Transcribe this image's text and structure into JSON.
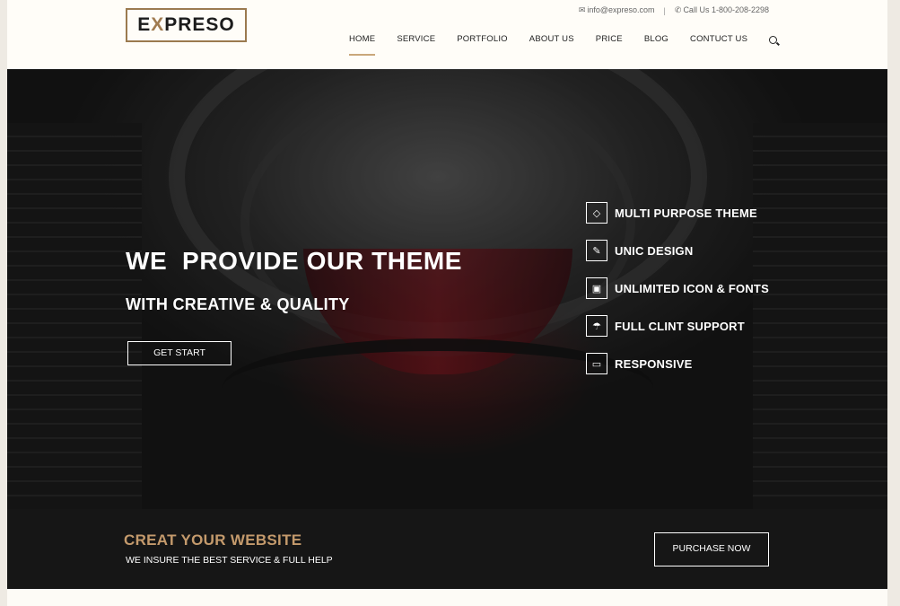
{
  "brand": {
    "logo_first": "E",
    "logo_accent": "X",
    "logo_rest": "PRESO"
  },
  "topbar": {
    "email": "info@expreso.com",
    "separator": "|",
    "phone": "Call Us 1-800-208-2298"
  },
  "nav": {
    "items": [
      "HOME",
      "SERVICE",
      "PORTFOLIO",
      "ABOUT US",
      "PRICE",
      "BLOG",
      "CONTUCT US"
    ],
    "active": "HOME"
  },
  "hero": {
    "title": "WE  PROVIDE OUR THEME",
    "subtitle": "WITH CREATIVE & QUALITY",
    "button": "GET START"
  },
  "features": [
    {
      "label": "MULTI PURPOSE THEME",
      "icon": "diamond-icon"
    },
    {
      "label": "UNIC DESIGN",
      "icon": "pencil-icon"
    },
    {
      "label": "UNLIMITED ICON & FONTS",
      "icon": "briefcase-icon"
    },
    {
      "label": "FULL CLINT SUPPORT",
      "icon": "umbrella-icon"
    },
    {
      "label": "RESPONSIVE",
      "icon": "desktop-icon"
    }
  ],
  "cta": {
    "title": "CREAT YOUR WEBSITE",
    "subtitle": "WE INSURE THE BEST SERVICE & FULL HELP",
    "button": "PURCHASE NOW"
  },
  "colors": {
    "accent": "#c49a6c",
    "logo_border": "#9b7a4f",
    "dark": "#161616"
  }
}
